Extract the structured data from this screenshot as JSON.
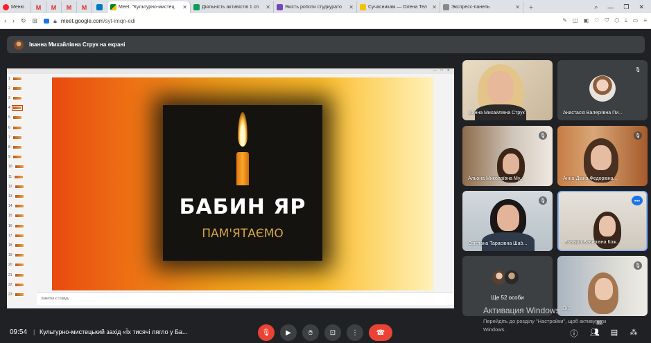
{
  "browser": {
    "menu_label": "Меню",
    "tabs": [
      {
        "icon": "gmail-icon",
        "label": "M"
      },
      {
        "icon": "gmail-icon",
        "label": "M"
      },
      {
        "icon": "gmail-icon",
        "label": "M"
      },
      {
        "icon": "gmail-icon",
        "label": "M"
      },
      {
        "icon": "trello-icon",
        "label": ""
      },
      {
        "icon": "meet-icon",
        "label": "Meet: \"Культурно-мистец",
        "active": true
      },
      {
        "icon": "sheets-icon",
        "label": "Діяльність активістів 1 сп"
      },
      {
        "icon": "forms-icon",
        "label": "Якість роботи студкурато"
      },
      {
        "icon": "site-icon",
        "label": "Сучасникам — Олена Тел"
      },
      {
        "icon": "grid-icon",
        "label": "Экспресс-панель"
      }
    ],
    "url_host": "meet.google.com",
    "url_path": "/syt-imqn-edi"
  },
  "banner": {
    "presenter": "Іванна Михайлівна Струк на екрані"
  },
  "presentation": {
    "thumb_numbers": [
      "1",
      "2",
      "3",
      "4",
      "5",
      "6",
      "7",
      "8",
      "9",
      "10",
      "11",
      "12",
      "13",
      "14",
      "15",
      "16",
      "17",
      "18",
      "19",
      "20",
      "21",
      "22",
      "23"
    ],
    "notes_placeholder": "Заметки к слайду",
    "slide_title": "БАБИН ЯР",
    "slide_subtitle": "ПАМ'ЯТАЄМО"
  },
  "participants": [
    {
      "name": "Іванна Михайлівна Струк",
      "muted": false
    },
    {
      "name": "Анастасія Валеріївна Пи...",
      "muted": true
    },
    {
      "name": "Альона Миколаївна Му...",
      "muted": true
    },
    {
      "name": "Анна-Діана Федорівна...",
      "muted": true
    },
    {
      "name": "Світлана Тарасівна Шаб...",
      "muted": true
    },
    {
      "name": "Ельвіра Василівна Кож...",
      "muted": false
    },
    {
      "name": "Ві...",
      "muted": true
    }
  ],
  "more_people": "Ще 52 особи",
  "activation": {
    "title": "Активация Windows",
    "subtitle": "Перейдіть до розділу \"Настройки\", щоб активувати Windows."
  },
  "bottom": {
    "time": "09:54",
    "separator": "|",
    "meeting_title": "Культурно-мистецький захід «Їх тисячі лягло у Ба...",
    "people_count": "60"
  }
}
